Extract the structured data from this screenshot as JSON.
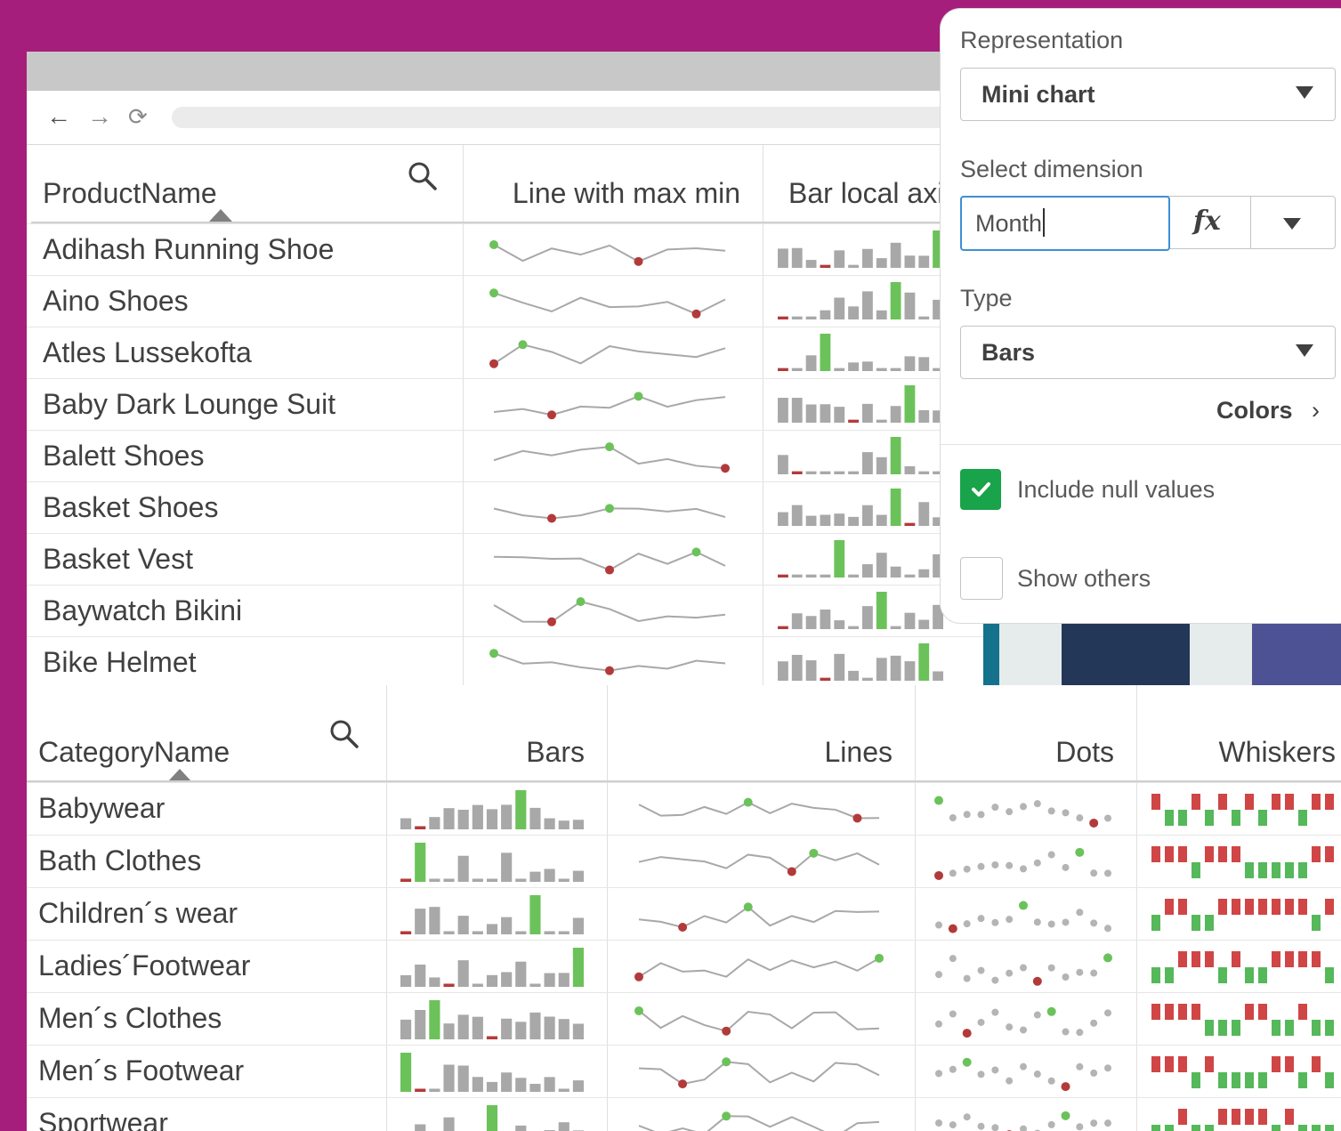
{
  "browser": {
    "nav_back": "←",
    "nav_forward": "→",
    "nav_reload": "⟳"
  },
  "table1": {
    "headers": [
      "ProductName",
      "Line with max min",
      "Bar local axi"
    ],
    "rows": [
      "Adihash Running Shoe",
      "Aino Shoes",
      "Atles Lussekofta",
      "Baby Dark Lounge Suit",
      "Balett Shoes",
      "Basket Shoes",
      "Basket Vest",
      "Baywatch Bikini",
      "Bike Helmet"
    ]
  },
  "table2": {
    "headers": [
      "CategoryName",
      "Bars",
      "Lines",
      "Dots",
      "Whiskers"
    ],
    "rows": [
      "Babywear",
      "Bath Clothes",
      "Children´s wear",
      "Ladies´Footwear",
      "Men´s Clothes",
      "Men´s Footwear",
      "Sportwear"
    ]
  },
  "panel": {
    "representation_label": "Representation",
    "representation_value": "Mini chart",
    "dimension_label": "Select dimension",
    "dimension_value": "Month",
    "fx_label": "fx",
    "type_label": "Type",
    "type_value": "Bars",
    "colors_label": "Colors",
    "colors_chevron": "›",
    "include_null_label": "Include null values",
    "include_null_checked": true,
    "show_others_label": "Show others",
    "show_others_checked": false
  },
  "colors": {
    "background": "#a61e7b",
    "check_green": "#19a34a",
    "spark_gray": "#a8a8a8",
    "max_green": "#6cc25a",
    "min_red": "#b33a3a"
  }
}
